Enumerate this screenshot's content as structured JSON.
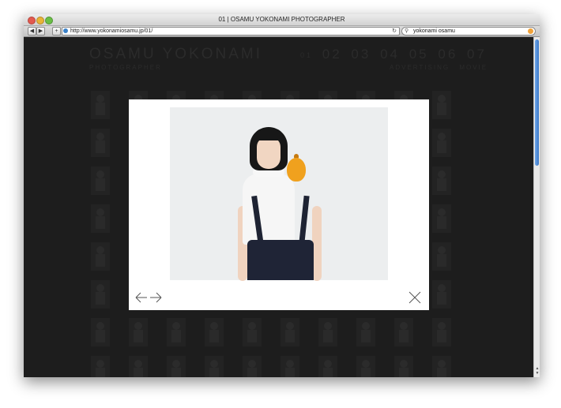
{
  "window": {
    "title": "01 | OSAMU YOKONAMI PHOTOGRAPHER"
  },
  "toolbar": {
    "back_label": "◀",
    "forward_label": "▶",
    "add_label": "+",
    "url": "http://www.yokonamiosamu.jp/01/",
    "search_value": "yokonami osamu"
  },
  "site": {
    "name": "OSAMU YOKONAMI",
    "subtitle": "PHOTOGRAPHER",
    "pages": [
      "01",
      "02",
      "03",
      "04",
      "05",
      "06",
      "07"
    ],
    "sections": [
      "ADVERTISING",
      "MOVIE"
    ]
  },
  "colors": {
    "page_background": "#1d1d1d",
    "lightbox": "#ffffff",
    "dim_text": "#2b2b2b"
  },
  "icons": {
    "prev": "arrow-left-icon",
    "next": "arrow-right-icon",
    "close": "close-x-icon"
  }
}
